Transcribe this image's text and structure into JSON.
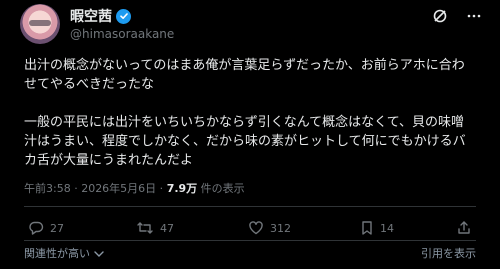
{
  "tweet": {
    "display_name": "暇空茜",
    "handle": "@himasoraakane",
    "paragraphs": [
      "出汁の概念がないってのはまあ俺が言葉足らずだったか、お前らアホに合わせてやるべきだったな",
      "一般の平民には出汁をいちいちかならず引くなんて概念はなくて、貝の味噌汁はうまい、程度でしかなく、だから味の素がヒットして何にでもかけるバカ舌が大量にうまれたんだよ"
    ],
    "timestamp": "午前3:58 · 2026年5月6日 · ",
    "views_count": "7.9万",
    "views_label": " 件の表示"
  },
  "actions": {
    "replies": "27",
    "retweets": "47",
    "likes": "312",
    "bookmarks": "14"
  },
  "footer": {
    "left_label": "関連性が高い",
    "right_label": "引用を表示"
  },
  "colors": {
    "background": "#000000",
    "text": "#e7e9ea",
    "muted": "#71767b",
    "verified": "#1d9bf0"
  }
}
